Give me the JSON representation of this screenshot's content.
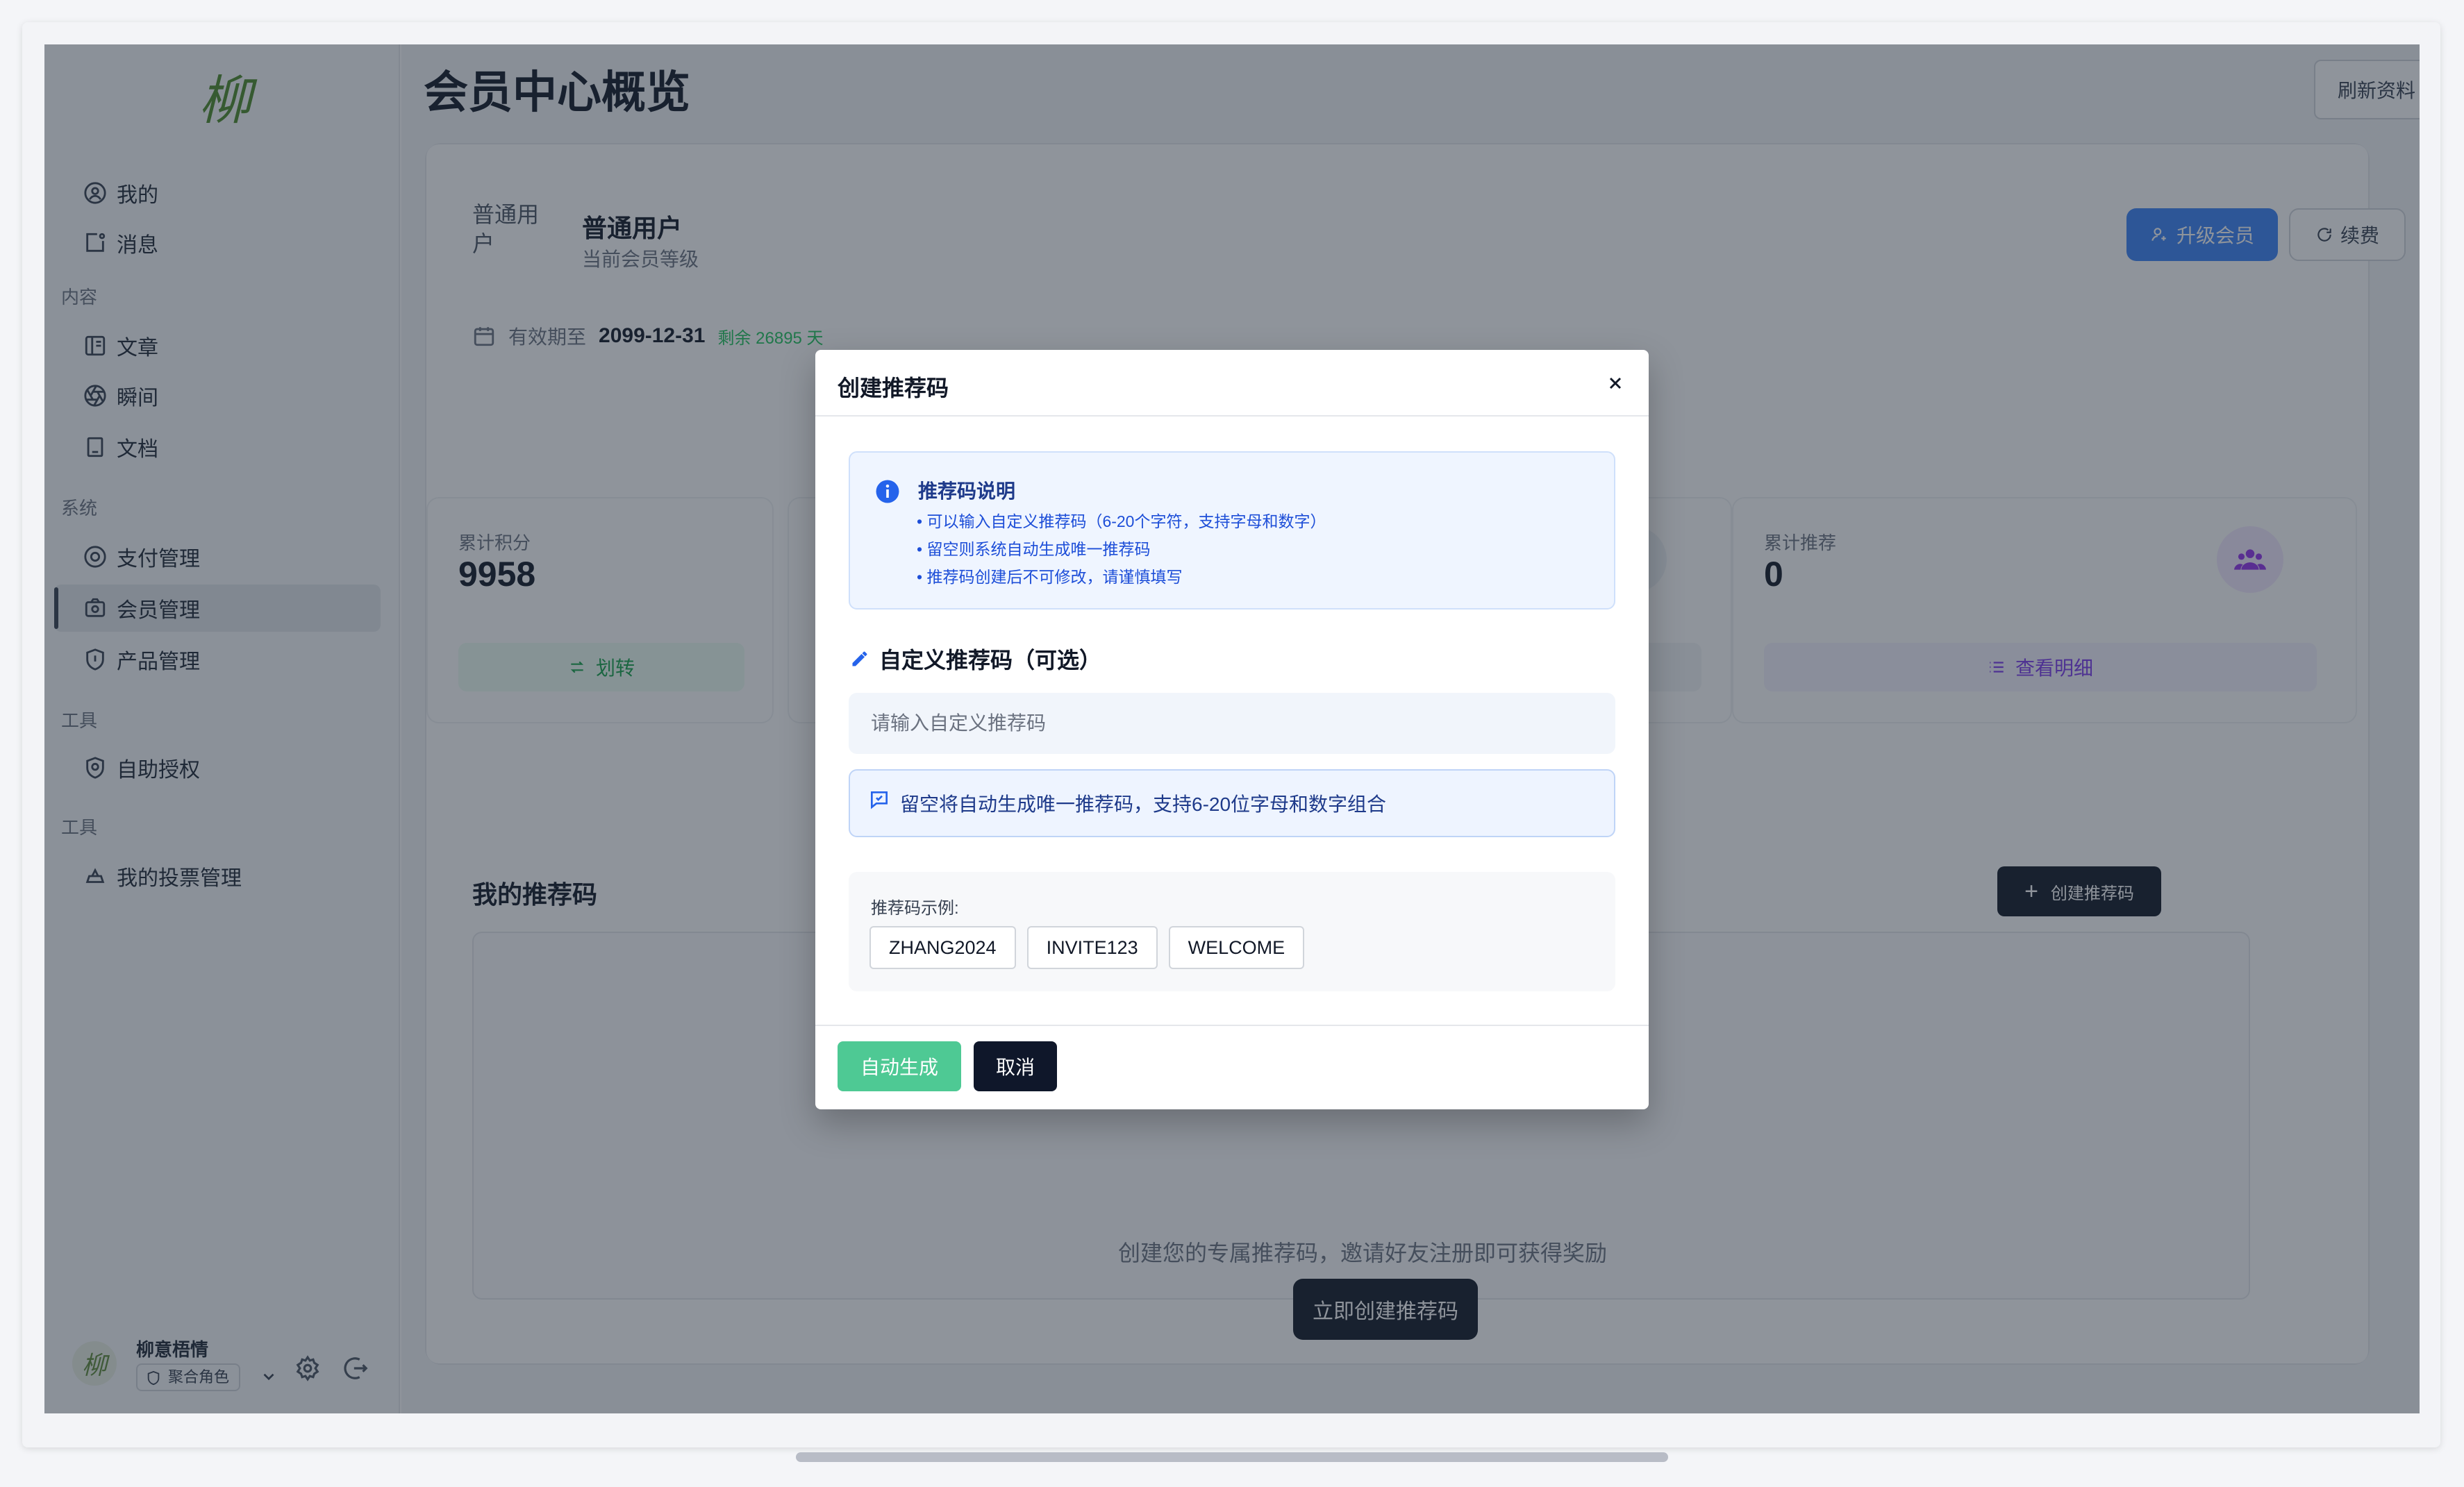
{
  "app": {
    "logo_text": "柳"
  },
  "sidebar": {
    "items": [
      {
        "label": "我的",
        "icon": "user-circle-icon"
      },
      {
        "label": "消息",
        "icon": "message-icon"
      },
      {
        "label": "文章",
        "icon": "article-icon"
      },
      {
        "label": "瞬间",
        "icon": "aperture-icon"
      },
      {
        "label": "文档",
        "icon": "document-icon"
      },
      {
        "label": "支付管理",
        "icon": "payment-icon"
      },
      {
        "label": "会员管理",
        "icon": "member-icon",
        "active": true
      },
      {
        "label": "产品管理",
        "icon": "shield-icon"
      },
      {
        "label": "自助授权",
        "icon": "shield-check-icon"
      },
      {
        "label": "我的投票管理",
        "icon": "vote-icon"
      }
    ],
    "sections": [
      "内容",
      "系统",
      "工具",
      "工具"
    ],
    "user": {
      "name": "柳意梧情",
      "role": "聚合角色",
      "avatar_text": "柳"
    }
  },
  "main": {
    "title": "会员中心概览",
    "refresh_label": "刷新资料",
    "membership": {
      "avatar_alt": "普通用户",
      "level_name": "普通用户",
      "level_caption": "当前会员等级",
      "upgrade_label": "升级会员",
      "renew_label": "续费",
      "expire_label": "有效期至",
      "expire_date": "2099-12-31",
      "remaining": "剩余 26895 天"
    },
    "stats": [
      {
        "label": "累计积分",
        "value": "9958",
        "action": "划转"
      },
      {
        "label": "累计推荐",
        "value": "0",
        "action": "查看明细"
      }
    ],
    "referral": {
      "title": "我的推荐码",
      "create_label": "创建推荐码",
      "empty_text": "创建您的专属推荐码，邀请好友注册即可获得奖励",
      "empty_button": "立即创建推荐码"
    }
  },
  "modal": {
    "title": "创建推荐码",
    "info_title": "推荐码说明",
    "info_lines": [
      "• 可以输入自定义推荐码（6-20个字符，支持字母和数字）",
      "• 留空则系统自动生成唯一推荐码",
      "• 推荐码创建后不可修改，请谨慎填写"
    ],
    "field_label": "自定义推荐码（可选）",
    "field_placeholder": "请输入自定义推荐码",
    "field_value": "",
    "hint": "留空将自动生成唯一推荐码，支持6-20位字母和数字组合",
    "examples_label": "推荐码示例:",
    "examples": [
      "ZHANG2024",
      "INVITE123",
      "WELCOME"
    ],
    "auto_label": "自动生成",
    "cancel_label": "取消"
  },
  "colors": {
    "primary": "#3b82f6",
    "success": "#4ec994",
    "dark": "#0f172a",
    "overlay": "rgba(31,41,55,0.5)"
  }
}
